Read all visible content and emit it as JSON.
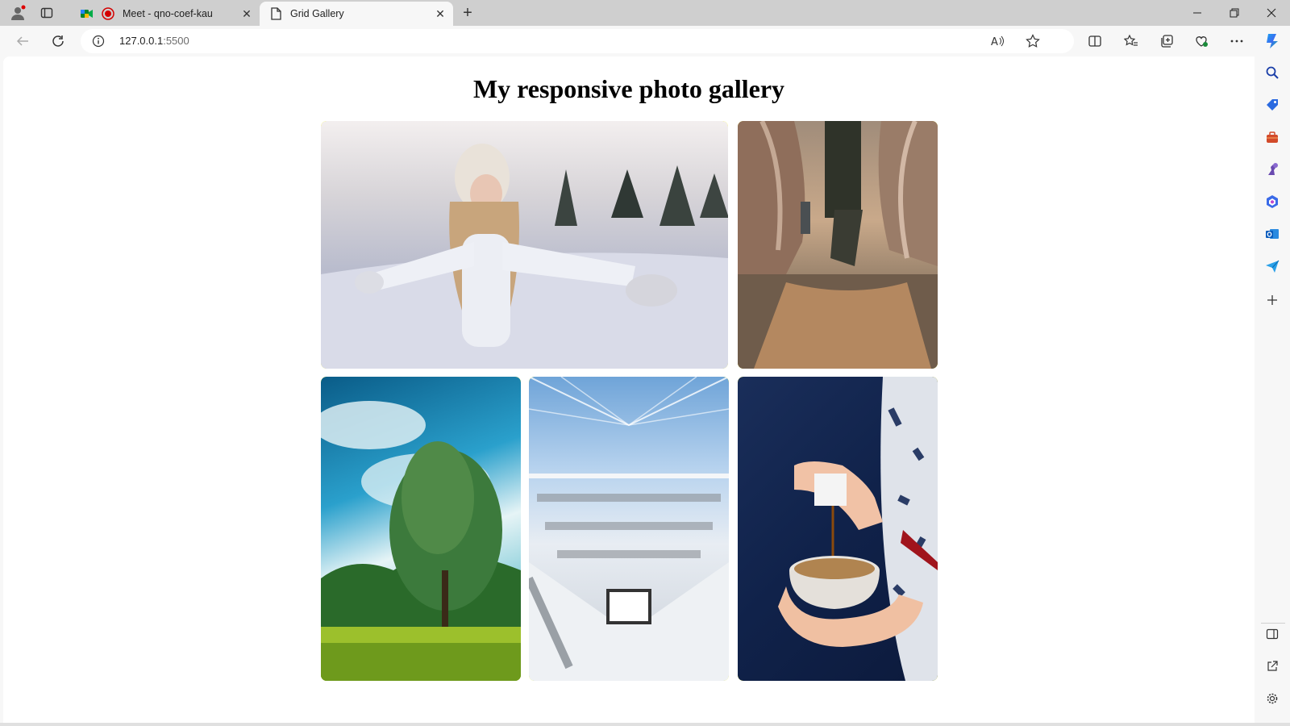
{
  "tabs": [
    {
      "title": "Meet - qno-coef-kau",
      "active": false
    },
    {
      "title": "Grid Gallery",
      "active": true
    }
  ],
  "address": {
    "host": "127.0.0.1",
    "port": ":5500"
  },
  "page": {
    "heading": "My responsive photo gallery",
    "photos": [
      {
        "name": "girl-in-snow",
        "alt": "Girl in snow with arms outstretched"
      },
      {
        "name": "canyon-hiker",
        "alt": "Hiker walking through canyon"
      },
      {
        "name": "green-tree",
        "alt": "Tree in green field with blue sky"
      },
      {
        "name": "library-interior",
        "alt": "Modern white library interior"
      },
      {
        "name": "pouring-syrup",
        "alt": "Hands pouring syrup into granola bowl"
      }
    ]
  },
  "colors": {
    "frame_accent": "#ffff00",
    "accent_blue": "#0f6cbd"
  }
}
